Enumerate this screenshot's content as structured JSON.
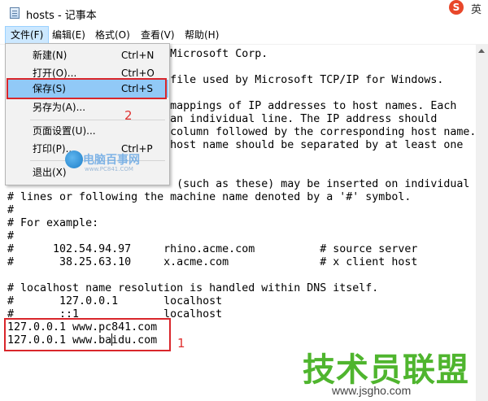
{
  "window": {
    "title": "hosts - 记事本"
  },
  "ime": {
    "badge": "S",
    "label": "英"
  },
  "menubar": [
    {
      "label": "文件(F)"
    },
    {
      "label": "编辑(E)"
    },
    {
      "label": "格式(O)"
    },
    {
      "label": "查看(V)"
    },
    {
      "label": "帮助(H)"
    }
  ],
  "file_menu": [
    {
      "label": "新建(N)",
      "shortcut": "Ctrl+N"
    },
    {
      "label": "打开(O)...",
      "shortcut": "Ctrl+O"
    },
    {
      "label": "保存(S)",
      "shortcut": "Ctrl+S"
    },
    {
      "label": "另存为(A)...",
      "shortcut": ""
    },
    {
      "label": "页面设置(U)...",
      "shortcut": ""
    },
    {
      "label": "打印(P)...",
      "shortcut": "Ctrl+P"
    },
    {
      "label": "退出(X)",
      "shortcut": ""
    }
  ],
  "editor_lines": [
    "                         Microsoft Corp.",
    "",
    "                         file used by Microsoft TCP/IP for Windows.",
    "",
    "                         mappings of IP addresses to host names. Each",
    "                         an individual line. The IP address should",
    "                         column followed by the corresponding host name.",
    "                         host name should be separated by at least one",
    "",
    "",
    "                          (such as these) may be inserted on individual",
    "# lines or following the machine name denoted by a '#' symbol.",
    "#",
    "# For example:",
    "#",
    "#      102.54.94.97     rhino.acme.com          # source server",
    "#       38.25.63.10     x.acme.com              # x client host",
    "",
    "# localhost name resolution is handled within DNS itself.",
    "#       127.0.0.1       localhost",
    "#       ::1             localhost",
    "127.0.0.1 www.pc841.com",
    "127.0.0.1 www.baidu.com"
  ],
  "annotations": {
    "one": "1",
    "two": "2"
  },
  "watermarks": {
    "center_brand": "电脑百事网",
    "center_url": "www.PC841.COM",
    "corner_brand": "技术员联盟",
    "corner_url": "www.jsgho.com"
  }
}
